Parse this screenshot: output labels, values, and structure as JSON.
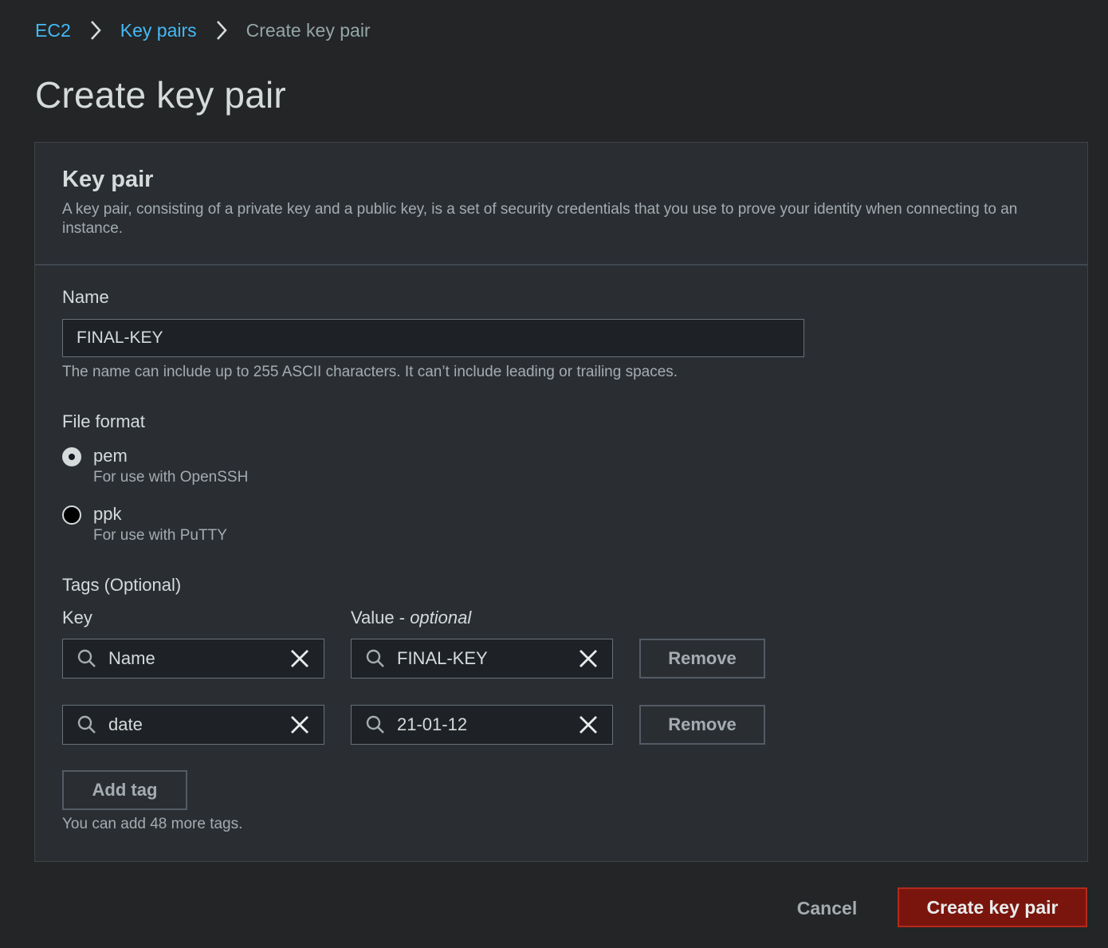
{
  "breadcrumb": {
    "items": [
      {
        "label": "EC2"
      },
      {
        "label": "Key pairs"
      },
      {
        "label": "Create key pair"
      }
    ]
  },
  "page": {
    "title": "Create key pair"
  },
  "key_pair_panel": {
    "title": "Key pair",
    "description": "A key pair, consisting of a private key and a public key, is a set of security credentials that you use to prove your identity when connecting to an instance.",
    "name_field": {
      "label": "Name",
      "value": "FINAL-KEY",
      "hint": "The name can include up to 255 ASCII characters. It can’t include leading or trailing spaces."
    },
    "file_format": {
      "label": "File format",
      "options": [
        {
          "label": "pem",
          "description": "For use with OpenSSH",
          "selected": true
        },
        {
          "label": "ppk",
          "description": "For use with PuTTY",
          "selected": false
        }
      ]
    },
    "tags": {
      "label": "Tags (Optional)",
      "key_header": "Key",
      "value_header_prefix": "Value - ",
      "value_header_optional": "optional",
      "rows": [
        {
          "key": "Name",
          "value": "FINAL-KEY",
          "remove_label": "Remove"
        },
        {
          "key": "date",
          "value": "21-01-12",
          "remove_label": "Remove"
        }
      ],
      "add_tag_label": "Add tag",
      "remaining_hint": "You can add 48 more tags."
    }
  },
  "footer": {
    "cancel_label": "Cancel",
    "create_label": "Create key pair"
  },
  "colors": {
    "background": "#232526",
    "panel": "#2a2e33",
    "link": "#44b9f6",
    "primary_button": "#7a150e",
    "primary_border": "#b42a1d"
  },
  "icons": {
    "breadcrumb_separator": "chevron-right-icon",
    "tag_search": "search-icon",
    "tag_clear": "close-icon"
  }
}
